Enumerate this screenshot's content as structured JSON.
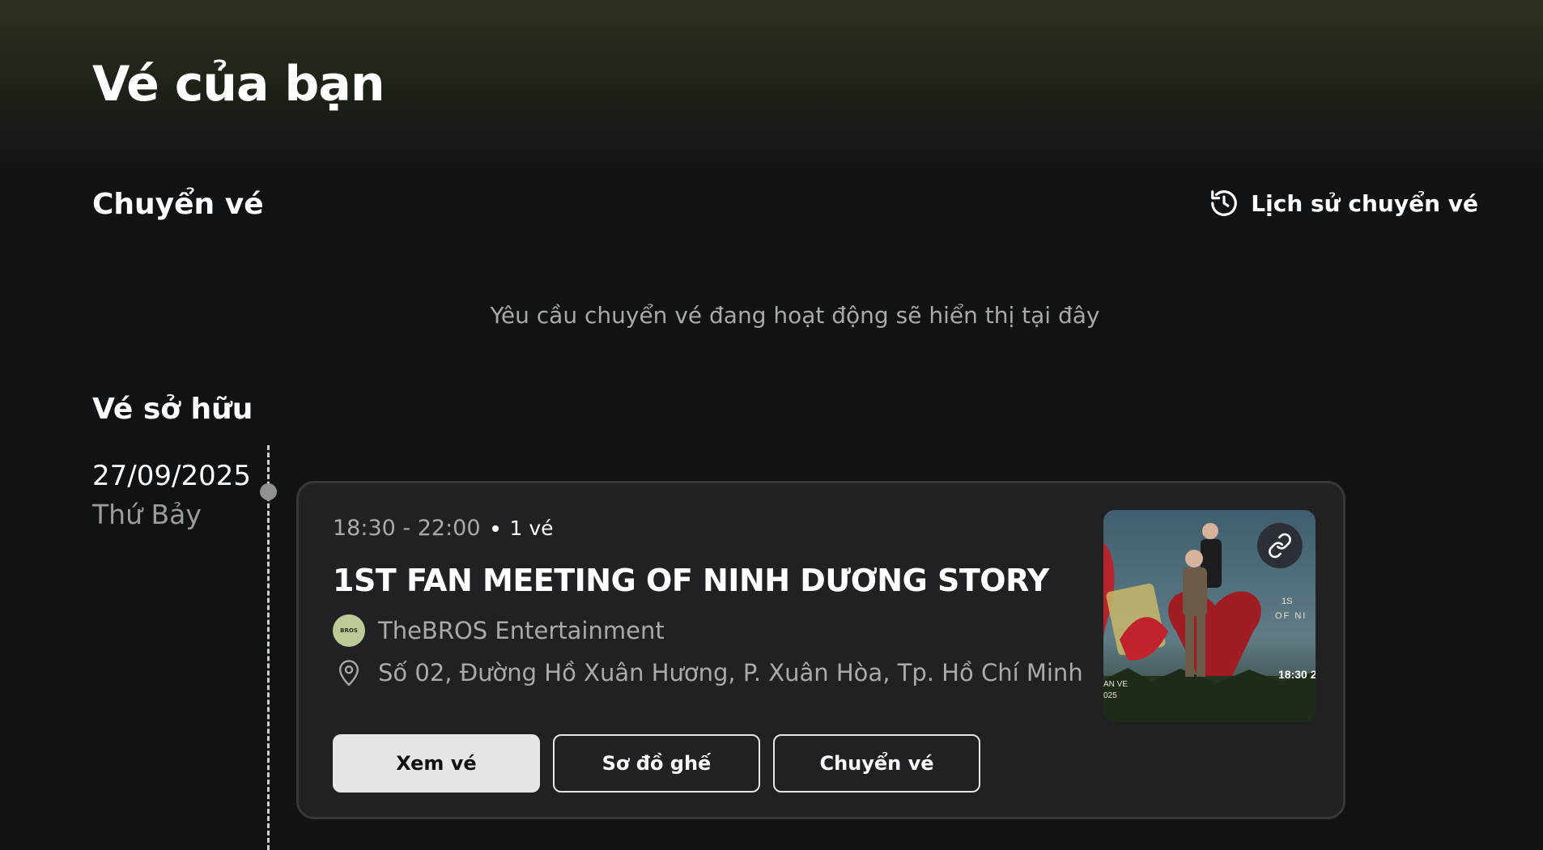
{
  "page": {
    "title": "Vé của bạn"
  },
  "transfer": {
    "title": "Chuyển vé",
    "history_label": "Lịch sử chuyển vé",
    "empty_message": "Yêu cầu chuyển vé đang hoạt động sẽ hiển thị tại đây"
  },
  "owned": {
    "title": "Vé sở hữu",
    "groups": [
      {
        "date": "27/09/2025",
        "weekday": "Thứ Bảy",
        "tickets": [
          {
            "time": "18:30 - 22:00",
            "count": "1 vé",
            "title": "1ST FAN MEETING OF NINH DƯƠNG STORY",
            "organizer": "TheBROS Entertainment",
            "organizer_logo_text": "BROS",
            "venue": "Số 02, Đường Hồ Xuân Hương, P. Xuân Hòa, Tp. Hồ Chí Minh",
            "poster_text": [
              "1S",
              "OF NI",
              "18:30 2",
              "AN VE",
              "025"
            ],
            "actions": {
              "view": "Xem vé",
              "seat_map": "Sơ đồ ghế",
              "transfer": "Chuyển vé"
            }
          }
        ]
      }
    ]
  },
  "icons": {
    "history": "history-clock-icon",
    "location": "map-pin-icon",
    "link": "link-icon"
  },
  "colors": {
    "background": "#111214",
    "card": "#212124",
    "muted_text": "#a9a9ae",
    "primary_button": "#e5e5ea",
    "organizer_logo": "#bccb98"
  }
}
